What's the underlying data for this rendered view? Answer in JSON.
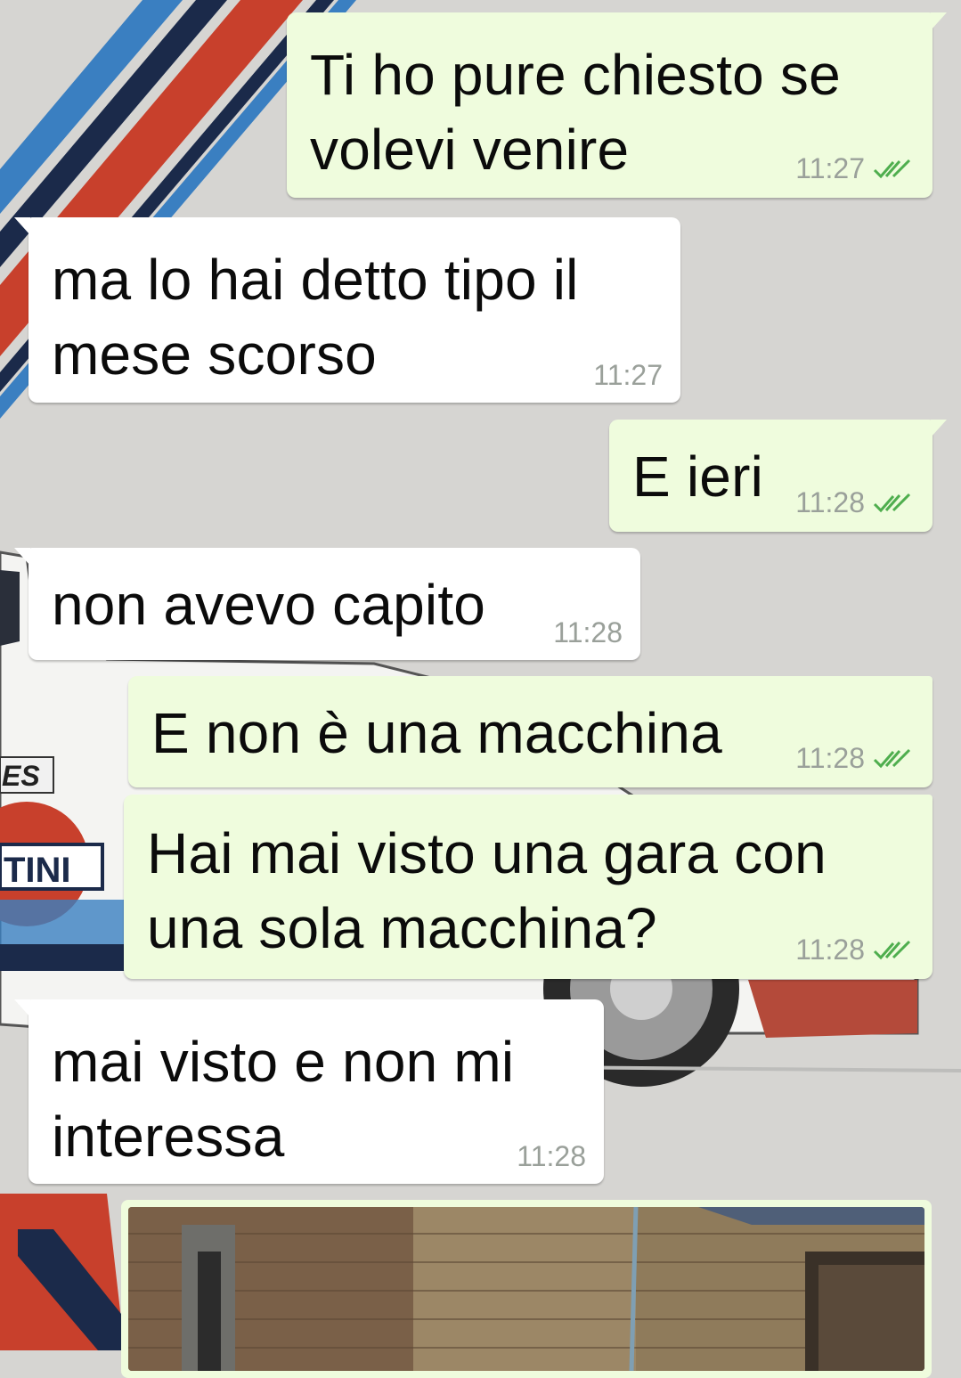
{
  "chat": {
    "messages": [
      {
        "direction": "outgoing",
        "text": "Ti ho pure chiesto se\nvolevi venire",
        "time": "11:27",
        "status": "read"
      },
      {
        "direction": "incoming",
        "text": "ma lo hai detto tipo il\nmese scorso",
        "time": "11:27"
      },
      {
        "direction": "outgoing",
        "text": "E ieri",
        "time": "11:28",
        "status": "read"
      },
      {
        "direction": "incoming",
        "text": "non avevo capito",
        "time": "11:28"
      },
      {
        "direction": "outgoing",
        "text": "E non è una macchina",
        "time": "11:28",
        "status": "read"
      },
      {
        "direction": "outgoing",
        "text": "Hai mai visto una gara con\nuna sola macchina?",
        "time": "11:28",
        "status": "read"
      },
      {
        "direction": "incoming",
        "text": "mai visto e non mi\ninteressa",
        "time": "11:28"
      }
    ]
  },
  "wallpaper": {
    "car_sticker_top": "ES",
    "car_sticker_logo": "TINI",
    "stripe_colors": [
      "#c8402c",
      "#1b2a4a",
      "#3a7fc1"
    ]
  },
  "colors": {
    "outgoing_bubble": "#effcdd",
    "incoming_bubble": "#ffffff",
    "read_ticks": "#4fae4e",
    "timestamp": "#9aa09a"
  },
  "icons": {
    "read_receipt": "double-check-icon"
  }
}
